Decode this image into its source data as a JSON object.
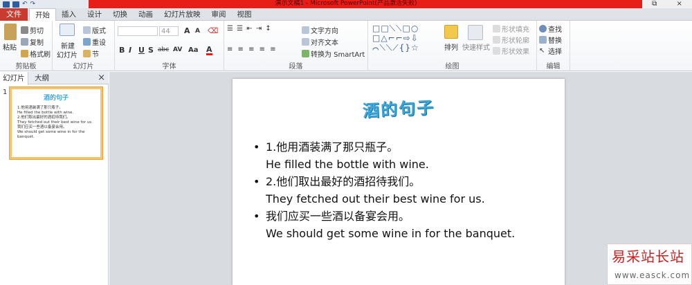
{
  "titlebar": {
    "title": "演示文稿1 - Microsoft PowerPoint(产品激活失败)",
    "win_restore": "⧉",
    "win_close": "×"
  },
  "tabs": {
    "file": "文件",
    "items": [
      "开始",
      "插入",
      "设计",
      "切换",
      "动画",
      "幻灯片放映",
      "审阅",
      "视图"
    ]
  },
  "ribbon": {
    "clipboard": {
      "label": "剪贴板",
      "paste": "粘贴",
      "cut": "剪切",
      "copy": "复制",
      "format_painter": "格式刷"
    },
    "slides": {
      "label": "幻灯片",
      "new_slide": "新建",
      "new_slide2": "幻灯片",
      "layout": "版式",
      "reset": "重设",
      "section": "节"
    },
    "font": {
      "label": "字体",
      "size": "44",
      "bold": "B",
      "italic": "I",
      "underline": "U",
      "shadow": "S",
      "strike": "abc",
      "spacing": "AV",
      "case": "Aa",
      "color": "A",
      "grow": "A",
      "shrink": "A"
    },
    "paragraph": {
      "label": "段落",
      "text_direction": "文字方向",
      "align_text": "对齐文本",
      "smartart": "转换为 SmartArt"
    },
    "drawing": {
      "label": "绘图",
      "arrange": "排列",
      "quick_styles": "快速样式",
      "shape_fill": "形状填充",
      "shape_outline": "形状轮廓",
      "shape_effects": "形状效果"
    },
    "editing": {
      "label": "编辑",
      "find": "查找",
      "replace": "替换",
      "select": "选择"
    }
  },
  "left_panel": {
    "tab_slides": "幻灯片",
    "tab_outline": "大纲",
    "close": "×",
    "slide_number": "1"
  },
  "slide": {
    "title": "酒的句子",
    "items": [
      {
        "cn": "1.他用酒装满了那只瓶子。",
        "en": "He filled the bottle with wine."
      },
      {
        "cn": "2.他们取出最好的酒招待我们。",
        "en": "They fetched out their best wine for us."
      },
      {
        "cn": "我们应买一些酒以备宴会用。",
        "en": "We should get some wine in for the banquet."
      }
    ],
    "bullet": "•"
  },
  "watermark": {
    "cn": "易采站长站",
    "url": "www.easck.com"
  },
  "colors": {
    "file_tab": "#c93b2e",
    "title_bar": "#e61e17",
    "slide_title": "#3aa6da",
    "thumb_border": "#f5c46b"
  }
}
